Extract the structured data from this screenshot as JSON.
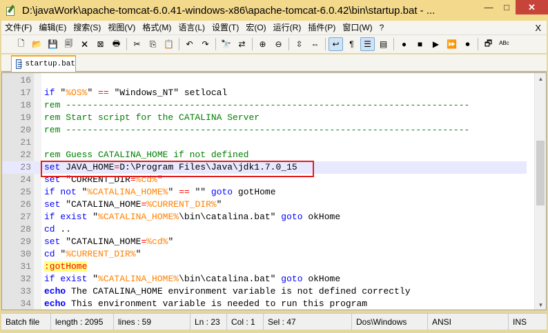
{
  "window": {
    "title": "D:\\javaWork\\apache-tomcat-6.0.41-windows-x86\\apache-tomcat-6.0.42\\bin\\startup.bat - ...",
    "minimize": "—",
    "maximize": "□",
    "close": "✕"
  },
  "menubar": {
    "items": [
      "文件(F)",
      "编辑(E)",
      "搜索(S)",
      "视图(V)",
      "格式(M)",
      "语言(L)",
      "设置(T)",
      "宏(O)",
      "运行(R)",
      "插件(P)",
      "窗口(W)",
      "?"
    ],
    "close": "X"
  },
  "toolbar": {
    "buttons": [
      {
        "name": "new-file-icon",
        "glyph": "🗋"
      },
      {
        "name": "open-file-icon",
        "glyph": "📂"
      },
      {
        "name": "save-icon",
        "glyph": "💾"
      },
      {
        "name": "save-all-icon",
        "glyph": "🗐"
      },
      {
        "name": "close-file-icon",
        "glyph": "🗙"
      },
      {
        "name": "close-all-icon",
        "glyph": "⊠"
      },
      {
        "name": "print-icon",
        "glyph": "🖶"
      },
      {
        "sep": true
      },
      {
        "name": "cut-icon",
        "glyph": "✂"
      },
      {
        "name": "copy-icon",
        "glyph": "⎘"
      },
      {
        "name": "paste-icon",
        "glyph": "📋"
      },
      {
        "sep": true
      },
      {
        "name": "undo-icon",
        "glyph": "↶"
      },
      {
        "name": "redo-icon",
        "glyph": "↷"
      },
      {
        "sep": true
      },
      {
        "name": "find-icon",
        "glyph": "🔭"
      },
      {
        "name": "replace-icon",
        "glyph": "⇄"
      },
      {
        "sep": true
      },
      {
        "name": "zoom-in-icon",
        "glyph": "⊕"
      },
      {
        "name": "zoom-out-icon",
        "glyph": "⊖"
      },
      {
        "sep": true
      },
      {
        "name": "sync-vertical-icon",
        "glyph": "⇳"
      },
      {
        "name": "sync-horizontal-icon",
        "glyph": "⇔"
      },
      {
        "sep": true
      },
      {
        "name": "word-wrap-icon",
        "glyph": "↩",
        "active": true
      },
      {
        "name": "show-all-chars-icon",
        "glyph": "¶"
      },
      {
        "name": "indent-guide-icon",
        "glyph": "☰",
        "active": true
      },
      {
        "name": "doc-map-icon",
        "glyph": "▤"
      },
      {
        "sep": true
      },
      {
        "name": "record-macro-icon",
        "glyph": "●"
      },
      {
        "name": "stop-record-icon",
        "glyph": "■"
      },
      {
        "name": "play-macro-icon",
        "glyph": "▶"
      },
      {
        "name": "play-multiple-icon",
        "glyph": "⏩"
      },
      {
        "name": "save-macro-icon",
        "glyph": "⏺"
      },
      {
        "sep": true
      },
      {
        "name": "launch-icon",
        "glyph": "🗗"
      },
      {
        "name": "spellcheck-icon",
        "glyph": "ᴬᴮᶜ"
      }
    ]
  },
  "tab": {
    "label": "startup.bat"
  },
  "editor": {
    "current_line": 23,
    "lines": [
      {
        "n": "16",
        "segs": []
      },
      {
        "n": "17",
        "segs": [
          [
            "kw",
            "if"
          ],
          [
            "",
            " \""
          ],
          [
            "var",
            "%OS%"
          ],
          [
            "",
            "\" "
          ],
          [
            "op",
            "=="
          ],
          [
            "",
            " \"Windows_NT\" setlocal"
          ]
        ]
      },
      {
        "n": "18",
        "segs": [
          [
            "cmt",
            "rem ---------------------------------------------------------------------------"
          ]
        ]
      },
      {
        "n": "19",
        "segs": [
          [
            "cmt",
            "rem Start script for the CATALINA Server"
          ]
        ]
      },
      {
        "n": "20",
        "segs": [
          [
            "cmt",
            "rem ---------------------------------------------------------------------------"
          ]
        ]
      },
      {
        "n": "21",
        "segs": []
      },
      {
        "n": "22",
        "segs": [
          [
            "cmt",
            "rem Guess CATALINA_HOME if not defined"
          ]
        ]
      },
      {
        "n": "23",
        "segs": [
          [
            "kw",
            "set"
          ],
          [
            "",
            " JAVA_HOME"
          ],
          [
            "op",
            "="
          ],
          [
            "",
            "D:\\Program Files\\Java\\jdk1.7.0_15"
          ]
        ]
      },
      {
        "n": "24",
        "segs": [
          [
            "kw",
            "set"
          ],
          [
            "",
            " \"CURRENT_DIR"
          ],
          [
            "op",
            "="
          ],
          [
            "var",
            "%cd%"
          ],
          [
            "",
            "\""
          ]
        ]
      },
      {
        "n": "25",
        "segs": [
          [
            "kw",
            "if not"
          ],
          [
            "",
            " \""
          ],
          [
            "var",
            "%CATALINA_HOME%"
          ],
          [
            "",
            "\" "
          ],
          [
            "op",
            "=="
          ],
          [
            "",
            " \"\" "
          ],
          [
            "kw",
            "goto"
          ],
          [
            "",
            " gotHome"
          ]
        ]
      },
      {
        "n": "26",
        "segs": [
          [
            "kw",
            "set"
          ],
          [
            "",
            " \"CATALINA_HOME"
          ],
          [
            "op",
            "="
          ],
          [
            "var",
            "%CURRENT_DIR%"
          ],
          [
            "",
            "\""
          ]
        ]
      },
      {
        "n": "27",
        "segs": [
          [
            "kw",
            "if exist"
          ],
          [
            "",
            " \""
          ],
          [
            "var",
            "%CATALINA_HOME%"
          ],
          [
            "",
            "\\bin\\catalina.bat\" "
          ],
          [
            "kw",
            "goto"
          ],
          [
            "",
            " okHome"
          ]
        ]
      },
      {
        "n": "28",
        "segs": [
          [
            "kw",
            "cd"
          ],
          [
            "",
            " .."
          ]
        ]
      },
      {
        "n": "29",
        "segs": [
          [
            "kw",
            "set"
          ],
          [
            "",
            " \"CATALINA_HOME"
          ],
          [
            "op",
            "="
          ],
          [
            "var",
            "%cd%"
          ],
          [
            "",
            "\""
          ]
        ]
      },
      {
        "n": "30",
        "segs": [
          [
            "kw",
            "cd"
          ],
          [
            "",
            " \""
          ],
          [
            "var",
            "%CURRENT_DIR%"
          ],
          [
            "",
            "\""
          ]
        ]
      },
      {
        "n": "31",
        "segs": [
          [
            "lbl",
            ":gotHome"
          ]
        ]
      },
      {
        "n": "32",
        "segs": [
          [
            "kw",
            "if exist"
          ],
          [
            "",
            " \""
          ],
          [
            "var",
            "%CATALINA_HOME%"
          ],
          [
            "",
            "\\bin\\catalina.bat\" "
          ],
          [
            "kw",
            "goto"
          ],
          [
            "",
            " okHome"
          ]
        ]
      },
      {
        "n": "33",
        "segs": [
          [
            "kw-b",
            "echo"
          ],
          [
            "",
            " The CATALINA_HOME environment variable is not defined correctly"
          ]
        ]
      },
      {
        "n": "34",
        "segs": [
          [
            "kw-b",
            "echo"
          ],
          [
            "",
            " This environment variable is needed to run this program"
          ]
        ]
      }
    ]
  },
  "statusbar": {
    "file_type": "Batch file",
    "length": "length : 2095",
    "lines": "lines : 59",
    "ln": "Ln : 23",
    "col": "Col : 1",
    "sel": "Sel : 47",
    "eol": "Dos\\Windows",
    "encoding": "ANSI",
    "mode": "INS"
  }
}
